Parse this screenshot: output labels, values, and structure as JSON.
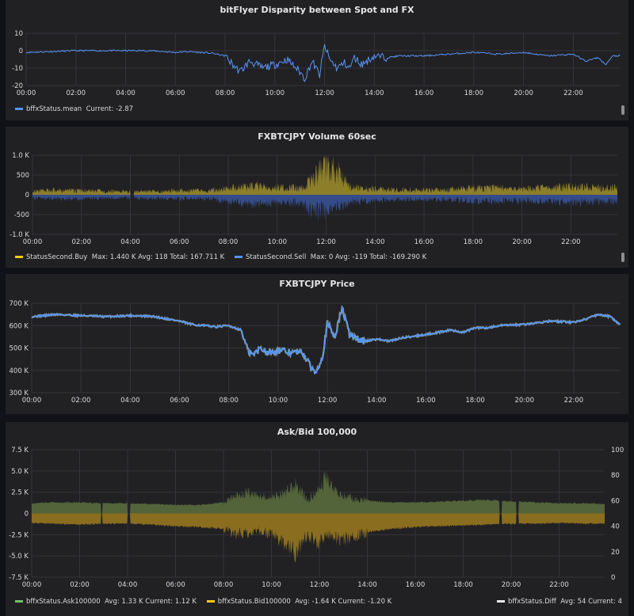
{
  "colors": {
    "background": "#111217",
    "panel": "#212124",
    "grid": "#34343a",
    "blue": "#5794f2",
    "yellow": "#f2cc0c",
    "olive": "#8d7f2a",
    "navy": "#344c8a",
    "green": "#53643a",
    "orange": "#8a6d1e",
    "white": "#e8e8e8"
  },
  "x_ticks": [
    "00:00",
    "02:00",
    "04:00",
    "06:00",
    "08:00",
    "10:00",
    "12:00",
    "14:00",
    "16:00",
    "18:00",
    "20:00",
    "22:00"
  ],
  "panels": [
    {
      "title": "bitFlyer Disparity between Spot and FX",
      "legend": [
        {
          "label": "bffxStatus.mean",
          "stats": "Current: -2.87",
          "color": "#5794f2"
        }
      ],
      "chart_data": {
        "type": "line",
        "title": "bitFlyer Disparity between Spot and FX",
        "xlabel": "",
        "ylabel": "",
        "x_ticks": [
          "00:00",
          "02:00",
          "04:00",
          "06:00",
          "08:00",
          "10:00",
          "12:00",
          "14:00",
          "16:00",
          "18:00",
          "20:00",
          "22:00"
        ],
        "ylim": [
          -20,
          10
        ],
        "y_ticks": [
          "10",
          "0",
          "-10",
          "-20"
        ],
        "grid": true,
        "series": [
          {
            "name": "bffxStatus.mean",
            "x_hours": [
              0,
              1,
              2,
              3,
              4,
              5,
              6,
              6.5,
              7,
              7.5,
              8,
              8.3,
              8.6,
              9,
              9.5,
              10,
              10.5,
              11,
              11.2,
              11.5,
              11.8,
              12,
              12.2,
              12.5,
              12.8,
              13,
              13.2,
              13.5,
              14,
              14.5,
              15,
              16,
              17,
              18,
              19,
              20,
              21,
              22,
              22.5,
              23,
              23.3,
              23.6,
              23.9
            ],
            "values": [
              -1,
              -0.5,
              0,
              0,
              0,
              0,
              -1,
              -0.5,
              -1,
              -1.5,
              -3,
              -8,
              -12,
              -6,
              -10,
              -8,
              -5,
              -12,
              -16,
              -6,
              -14,
              3,
              -5,
              -10,
              -7,
              -10,
              -4,
              -8,
              -3,
              -4,
              -3,
              -3,
              -2,
              -1,
              -2,
              -1,
              -3,
              -2,
              -6,
              -4,
              -8,
              -3,
              -2.87
            ]
          }
        ]
      }
    },
    {
      "title": "FXBTCJPY Volume 60sec",
      "legend": [
        {
          "label": "StatusSecond.Buy",
          "stats": "Max: 1.440 K  Avg: 118  Total: 167.711 K",
          "color": "#f2cc0c"
        },
        {
          "label": "StatusSecond.Sell",
          "stats": "Max: 0  Avg: -119  Total: -169.290 K",
          "color": "#5794f2"
        }
      ],
      "chart_data": {
        "type": "area",
        "title": "FXBTCJPY Volume 60sec",
        "xlabel": "",
        "ylabel": "",
        "x_ticks": [
          "00:00",
          "02:00",
          "04:00",
          "06:00",
          "08:00",
          "10:00",
          "12:00",
          "14:00",
          "16:00",
          "18:00",
          "20:00",
          "22:00"
        ],
        "ylim": [
          -1000,
          1000
        ],
        "y_ticks": [
          "1.0 K",
          "500",
          "0",
          "-500",
          "-1.0 K"
        ],
        "grid": true,
        "series": [
          {
            "name": "StatusSecond.Buy",
            "x_hours": [
              0,
              1,
              2,
              3,
              4,
              5,
              6,
              7,
              8,
              9,
              10,
              11,
              11.5,
              12,
              12.3,
              13,
              14,
              15,
              16,
              17,
              18,
              19,
              20,
              21,
              22,
              23,
              24
            ],
            "values": [
              120,
              140,
              130,
              110,
              100,
              110,
              130,
              120,
              200,
              260,
              240,
              220,
              500,
              1000,
              900,
              230,
              180,
              150,
              140,
              160,
              200,
              210,
              190,
              210,
              250,
              230,
              220
            ]
          },
          {
            "name": "StatusSecond.Sell",
            "x_hours": [
              0,
              1,
              2,
              3,
              4,
              5,
              6,
              7,
              8,
              9,
              10,
              11,
              11.5,
              12,
              12.3,
              13,
              14,
              15,
              16,
              17,
              18,
              19,
              20,
              21,
              22,
              23,
              24
            ],
            "values": [
              -110,
              -120,
              -120,
              -100,
              -100,
              -110,
              -120,
              -120,
              -200,
              -300,
              -260,
              -240,
              -550,
              -520,
              -400,
              -230,
              -170,
              -150,
              -140,
              -150,
              -190,
              -200,
              -180,
              -200,
              -240,
              -230,
              -220
            ]
          }
        ]
      }
    },
    {
      "title": "FXBTCJPY Price",
      "legend": [],
      "chart_data": {
        "type": "line",
        "title": "FXBTCJPY Price",
        "xlabel": "",
        "ylabel": "",
        "x_ticks": [
          "00:00",
          "02:00",
          "04:00",
          "06:00",
          "08:00",
          "10:00",
          "12:00",
          "14:00",
          "16:00",
          "18:00",
          "20:00",
          "22:00"
        ],
        "ylim": [
          300000,
          700000
        ],
        "y_ticks": [
          "700 K",
          "600 K",
          "500 K",
          "400 K",
          "300 K"
        ],
        "grid": true,
        "series": [
          {
            "x_hours": [
              0,
              1,
              2,
              3,
              4,
              5,
              6,
              6.5,
              7,
              7.5,
              8,
              8.5,
              8.8,
              9,
              9.3,
              9.6,
              10,
              10.5,
              11,
              11.3,
              11.5,
              11.8,
              12,
              12.3,
              12.6,
              12.9,
              13.2,
              13.5,
              14,
              14.5,
              15,
              16,
              17,
              17.5,
              18,
              18.5,
              19,
              20,
              21,
              22,
              22.5,
              23,
              23.5,
              23.9
            ],
            "values": [
              640000,
              650000,
              645000,
              640000,
              645000,
              640000,
              620000,
              605000,
              600000,
              595000,
              600000,
              580000,
              480000,
              470000,
              500000,
              480000,
              490000,
              480000,
              480000,
              420000,
              390000,
              460000,
              610000,
              550000,
              680000,
              560000,
              540000,
              530000,
              540000,
              530000,
              545000,
              560000,
              580000,
              570000,
              590000,
              590000,
              600000,
              605000,
              620000,
              615000,
              630000,
              650000,
              640000,
              600000
            ]
          }
        ]
      }
    },
    {
      "title": "Ask/Bid 100,000",
      "legend": [
        {
          "label": "bffxStatus.Ask100000",
          "stats": "Avg: 1.33 K  Current: 1.12 K",
          "color": "#73bf69"
        },
        {
          "label": "bffxStatus.Bid100000",
          "stats": "Avg: -1.64 K  Current: -1.20 K",
          "color": "#f2cc0c"
        }
      ],
      "legend_right": {
        "label": "bffxStatus.Diff",
        "stats": "Avg: 54  Current: 4",
        "color": "#e8e8e8"
      },
      "chart_data": {
        "type": "area",
        "title": "Ask/Bid 100,000",
        "xlabel": "",
        "ylabel": "",
        "x_ticks": [
          "00:00",
          "02:00",
          "04:00",
          "06:00",
          "08:00",
          "10:00",
          "12:00",
          "14:00",
          "16:00",
          "18:00",
          "20:00",
          "22:00"
        ],
        "ylim": [
          -7500,
          7500
        ],
        "y_ticks": [
          "7.5 K",
          "5.0 K",
          "2.5 K",
          "0",
          "-2.5 K",
          "-5.0 K",
          "-7.5 K"
        ],
        "y2lim": [
          0,
          100
        ],
        "y2_ticks": [
          "100",
          "80",
          "60",
          "40",
          "20",
          "0"
        ],
        "grid": true,
        "series": [
          {
            "name": "bffxStatus.Ask100000",
            "x_hours": [
              0,
              1,
              2,
              3,
              4,
              5,
              6,
              7,
              8,
              8.5,
              9,
              9.5,
              10,
              10.5,
              11,
              11.5,
              12,
              12.3,
              12.7,
              13,
              14,
              15,
              16,
              17,
              18,
              19,
              20,
              21,
              22,
              23,
              24
            ],
            "values": [
              1200,
              1300,
              1300,
              1200,
              1200,
              1100,
              1000,
              1000,
              1300,
              2000,
              2500,
              2000,
              2000,
              2300,
              3500,
              1500,
              3000,
              4500,
              2500,
              2000,
              1500,
              1300,
              1300,
              1400,
              1500,
              1600,
              1400,
              1300,
              1200,
              1200,
              1120
            ]
          },
          {
            "name": "bffxStatus.Bid100000",
            "x_hours": [
              0,
              1,
              2,
              3,
              4,
              5,
              6,
              7,
              8,
              8.5,
              9,
              9.5,
              10,
              10.5,
              11,
              11.5,
              12,
              12.3,
              12.7,
              13,
              14,
              15,
              16,
              17,
              18,
              19,
              20,
              21,
              22,
              23,
              24
            ],
            "values": [
              -1100,
              -1200,
              -1300,
              -1200,
              -1200,
              -1300,
              -1500,
              -1600,
              -1800,
              -2500,
              -2300,
              -2000,
              -2500,
              -3500,
              -4500,
              -2500,
              -3500,
              -2500,
              -3000,
              -3000,
              -2200,
              -1800,
              -1600,
              -1500,
              -1400,
              -1300,
              -1200,
              -1200,
              -1100,
              -1200,
              -1200
            ]
          }
        ]
      }
    }
  ]
}
